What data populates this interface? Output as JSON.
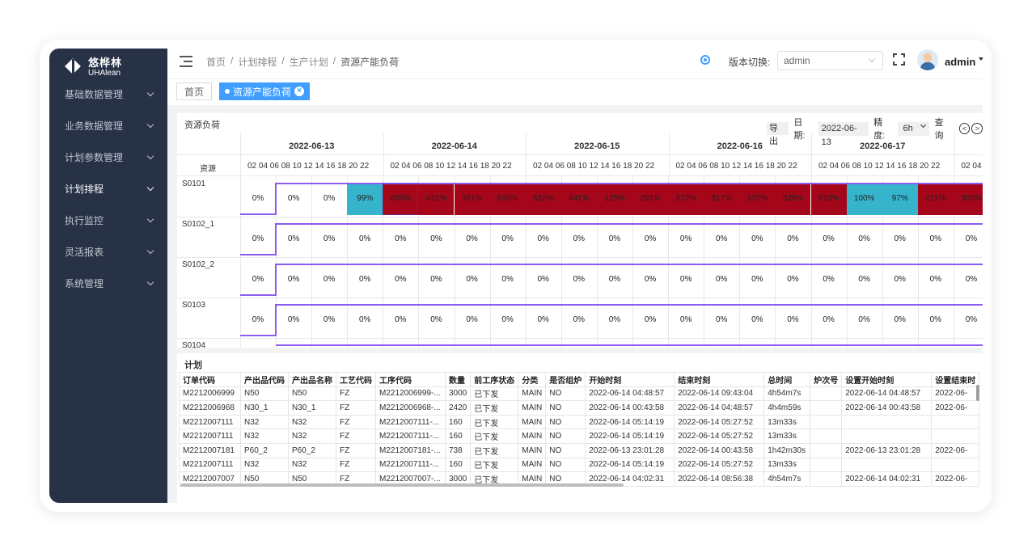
{
  "brand": {
    "name_cn": "悠桦林",
    "name_en": "UHAlean"
  },
  "sidebar": {
    "items": [
      {
        "label": "基础数据管理",
        "active": false
      },
      {
        "label": "业务数据管理",
        "active": false
      },
      {
        "label": "计划参数管理",
        "active": false
      },
      {
        "label": "计划排程",
        "active": true
      },
      {
        "label": "执行监控",
        "active": false
      },
      {
        "label": "灵活报表",
        "active": false
      },
      {
        "label": "系统管理",
        "active": false
      }
    ]
  },
  "header": {
    "breadcrumb": [
      "首页",
      "/",
      "计划排程",
      "/",
      "生产计划",
      "/",
      "资源产能负荷"
    ],
    "version_label": "版本切换:",
    "version_value": "admin",
    "username": "admin",
    "icons": [
      "menu-toggle-icon",
      "gear-icon",
      "fullscreen-icon",
      "avatar"
    ]
  },
  "tags": {
    "home": "首页",
    "active": "资源产能负荷"
  },
  "load": {
    "title": "资源负荷",
    "export_label": "导出",
    "date_label": "日期:",
    "date_value": "2022-06-13",
    "precision_label": "精度:",
    "precision_value": "6h",
    "query_label": "查 询",
    "resource_header": "资源",
    "days": [
      "2022-06-13",
      "2022-06-14",
      "2022-06-15",
      "2022-06-16",
      "2022-06-17"
    ],
    "hours_text": "02 04 06 08 10 12 14 16 18 20 22",
    "hours_partial": "02 04",
    "colors": {
      "overload": "#a6061a",
      "full": "#35b4cc",
      "line": "#8a5cf0"
    },
    "resources": [
      {
        "name": "S0101",
        "first": "0%",
        "values": [
          "0%",
          "0%",
          "99%",
          "609%",
          "631%",
          "361%",
          "638%",
          "522%",
          "441%",
          "125%",
          "291%",
          "272%",
          "517%",
          "237%",
          "329%",
          "610%",
          "100%",
          "97%",
          "211%",
          "300%"
        ]
      },
      {
        "name": "S0102_1",
        "first": "0%",
        "values": [
          "0%",
          "0%",
          "0%",
          "0%",
          "0%",
          "0%",
          "0%",
          "0%",
          "0%",
          "0%",
          "0%",
          "0%",
          "0%",
          "0%",
          "0%",
          "0%",
          "0%",
          "0%",
          "0%",
          "0%"
        ]
      },
      {
        "name": "S0102_2",
        "first": "0%",
        "values": [
          "0%",
          "0%",
          "0%",
          "0%",
          "0%",
          "0%",
          "0%",
          "0%",
          "0%",
          "0%",
          "0%",
          "0%",
          "0%",
          "0%",
          "0%",
          "0%",
          "0%",
          "0%",
          "0%",
          "0%"
        ]
      },
      {
        "name": "S0103",
        "first": "0%",
        "values": [
          "0%",
          "0%",
          "0%",
          "0%",
          "0%",
          "0%",
          "0%",
          "0%",
          "0%",
          "0%",
          "0%",
          "0%",
          "0%",
          "0%",
          "0%",
          "0%",
          "0%",
          "0%",
          "0%",
          "0%"
        ]
      },
      {
        "name": "S0104",
        "first": "",
        "values": []
      }
    ]
  },
  "plan": {
    "title": "计划",
    "columns": [
      "订单代码",
      "产出品代码",
      "产出品名称",
      "工艺代码",
      "工序代码",
      "数量",
      "前工序状态",
      "分类",
      "是否组炉",
      "开始时刻",
      "结束时刻",
      "总时间",
      "炉次号",
      "设置开始时刻",
      "设置结束时"
    ],
    "rows": [
      [
        "M2212006999",
        "N50",
        "N50",
        "FZ",
        "M2212006999-...",
        "3000",
        "已下发",
        "MAIN",
        "NO",
        "2022-06-14 04:48:57",
        "2022-06-14 09:43:04",
        "4h54m7s",
        "",
        "2022-06-14 04:48:57",
        "2022-06-"
      ],
      [
        "M2212006968",
        "N30_1",
        "N30_1",
        "FZ",
        "M2212006968-...",
        "2420",
        "已下发",
        "MAIN",
        "NO",
        "2022-06-14 00:43:58",
        "2022-06-14 04:48:57",
        "4h4m59s",
        "",
        "2022-06-14 00:43:58",
        "2022-06-"
      ],
      [
        "M2212007111",
        "N32",
        "N32",
        "FZ",
        "M2212007111-...",
        "160",
        "已下发",
        "MAIN",
        "NO",
        "2022-06-14 05:14:19",
        "2022-06-14 05:27:52",
        "13m33s",
        "",
        "",
        ""
      ],
      [
        "M2212007111",
        "N32",
        "N32",
        "FZ",
        "M2212007111-...",
        "160",
        "已下发",
        "MAIN",
        "NO",
        "2022-06-14 05:14:19",
        "2022-06-14 05:27:52",
        "13m33s",
        "",
        "",
        ""
      ],
      [
        "M2212007181",
        "P60_2",
        "P60_2",
        "FZ",
        "M2212007181-...",
        "738",
        "已下发",
        "MAIN",
        "NO",
        "2022-06-13 23:01:28",
        "2022-06-14 00:43:58",
        "1h42m30s",
        "",
        "2022-06-13 23:01:28",
        "2022-06-"
      ],
      [
        "M2212007111",
        "N32",
        "N32",
        "FZ",
        "M2212007111-...",
        "160",
        "已下发",
        "MAIN",
        "NO",
        "2022-06-14 05:14:19",
        "2022-06-14 05:27:52",
        "13m33s",
        "",
        "",
        ""
      ],
      [
        "M2212007007",
        "N50",
        "N50",
        "FZ",
        "M2212007007-...",
        "3000",
        "已下发",
        "MAIN",
        "NO",
        "2022-06-14 04:02:31",
        "2022-06-14 08:56:38",
        "4h54m7s",
        "",
        "2022-06-14 04:02:31",
        "2022-06-"
      ]
    ]
  }
}
